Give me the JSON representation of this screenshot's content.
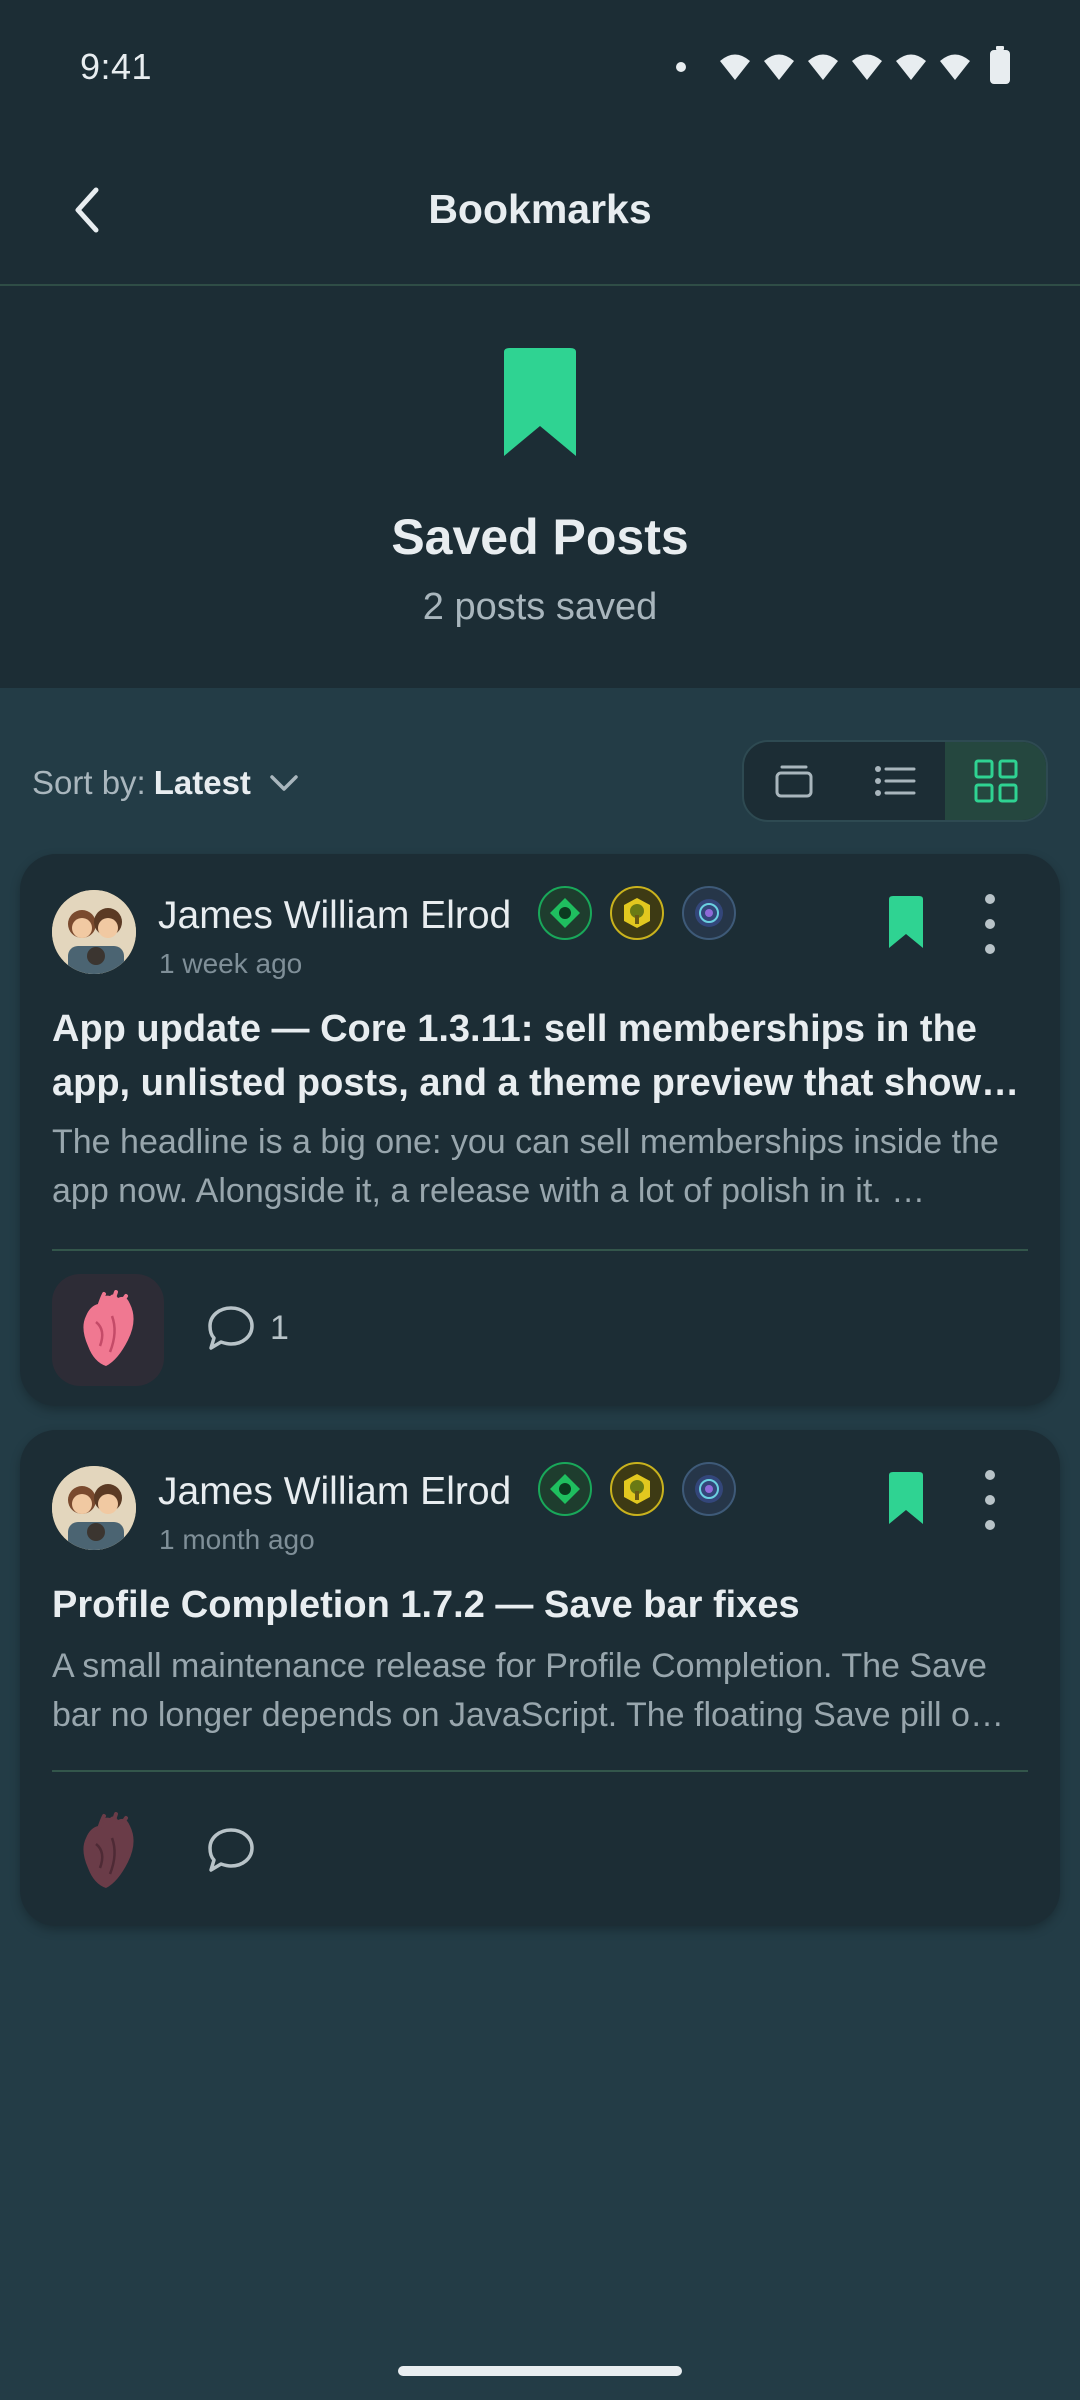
{
  "status_bar": {
    "time": "9:41"
  },
  "app_bar": {
    "title": "Bookmarks"
  },
  "hero": {
    "title": "Saved Posts",
    "subtitle": "2 posts saved"
  },
  "sort": {
    "label": "Sort by:",
    "value": "Latest"
  },
  "view_modes": [
    "cards",
    "list",
    "grid"
  ],
  "active_view_mode": "grid",
  "colors": {
    "accent": "#2fd392",
    "background": "#233c46",
    "surface": "#1c2d35"
  },
  "posts": [
    {
      "author": "James William Elrod",
      "time_ago": "1 week ago",
      "title": "App update — Core 1.3.11: sell memberships in the app, unlisted posts, and a theme preview that shows …",
      "excerpt": "The headline is a big one: you can sell memberships inside the app now. Alongside it, a release with a lot of polish in it. …",
      "comment_count": "1",
      "liked": true,
      "bookmarked": true
    },
    {
      "author": "James William Elrod",
      "time_ago": "1 month ago",
      "title": "Profile Completion 1.7.2 — Save bar fixes",
      "excerpt": "A small maintenance release for Profile Completion. The Save bar no longer depends on JavaScript. The floating Save pill o…",
      "comment_count": "",
      "liked": false,
      "bookmarked": true
    }
  ]
}
